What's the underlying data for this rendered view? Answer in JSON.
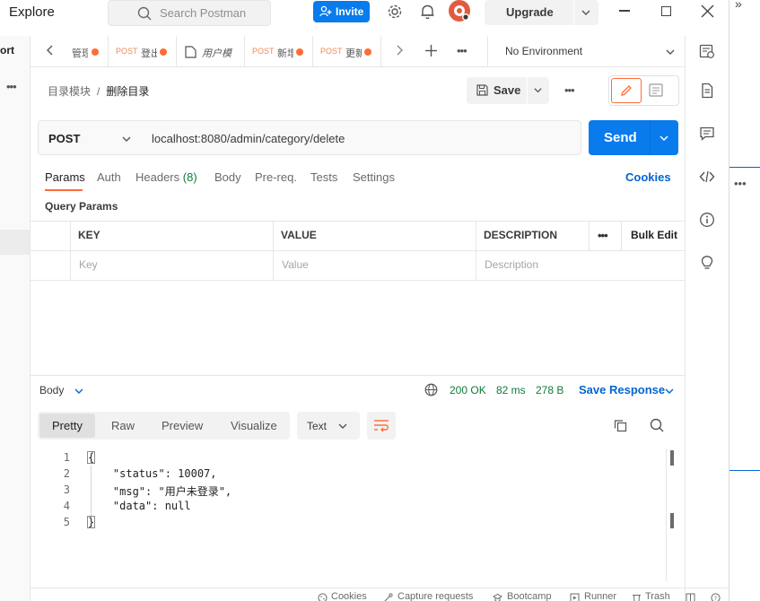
{
  "header": {
    "explore": "Explore",
    "search_placeholder": "Search Postman",
    "invite": "Invite",
    "upgrade": "Upgrade"
  },
  "left_sidebar": {
    "cut_label": "ort"
  },
  "tabs": [
    {
      "method": "",
      "name": "管理",
      "unsaved": true
    },
    {
      "method": "POST",
      "name": "登出",
      "unsaved": true
    },
    {
      "method": "",
      "name": "用户模",
      "unsaved": false
    },
    {
      "method": "POST",
      "name": "新增",
      "unsaved": true
    },
    {
      "method": "POST",
      "name": "更新",
      "unsaved": true
    }
  ],
  "environment": "No Environment",
  "breadcrumb": {
    "parent": "目录模块",
    "separator": "/",
    "current": "删除目录"
  },
  "toolbar": {
    "save": "Save"
  },
  "request": {
    "method": "POST",
    "url": "localhost:8080/admin/category/delete",
    "send": "Send"
  },
  "request_tabs": [
    {
      "label": "Params",
      "active": true
    },
    {
      "label": "Auth"
    },
    {
      "label": "Headers",
      "count": "(8)"
    },
    {
      "label": "Body"
    },
    {
      "label": "Pre-req."
    },
    {
      "label": "Tests"
    },
    {
      "label": "Settings"
    }
  ],
  "cookies": "Cookies",
  "query_params": {
    "title": "Query Params",
    "columns": [
      "KEY",
      "VALUE",
      "DESCRIPTION"
    ],
    "bulk_edit": "Bulk Edit",
    "placeholders": {
      "key": "Key",
      "value": "Value",
      "description": "Description"
    }
  },
  "response": {
    "body_label": "Body",
    "status": "200 OK",
    "time": "82 ms",
    "size": "278 B",
    "save_response": "Save Response",
    "formats": [
      "Pretty",
      "Raw",
      "Preview",
      "Visualize"
    ],
    "type": "Text",
    "lines": [
      {
        "n": "1",
        "text": "{"
      },
      {
        "n": "2",
        "text": "    \"status\": 10007,"
      },
      {
        "n": "3",
        "text": "    \"msg\": \"用户未登录\","
      },
      {
        "n": "4",
        "text": "    \"data\": null"
      },
      {
        "n": "5",
        "text": "}"
      }
    ]
  },
  "footer": {
    "cookies": "Cookies",
    "capture": "Capture requests",
    "bootcamp": "Bootcamp",
    "runner": "Runner",
    "trash": "Trash"
  },
  "colors": {
    "accent": "#ff6c37",
    "primary": "#097bed",
    "success": "#0f7c3a"
  }
}
